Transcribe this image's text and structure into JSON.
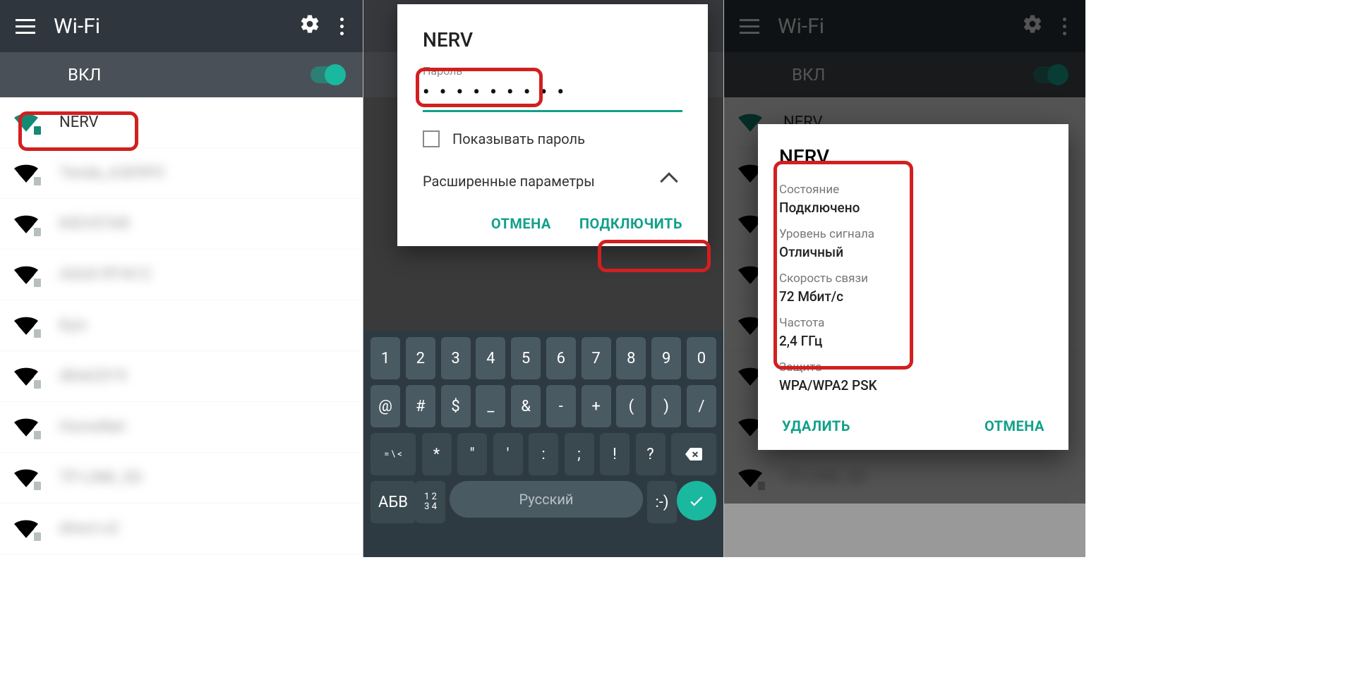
{
  "screen1": {
    "title": "Wi-Fi",
    "toggle_label": "ВКЛ",
    "networks": [
      {
        "name": "NERV",
        "highlighted": true
      },
      {
        "name": "Tenda_A3D9F0",
        "blur": true
      },
      {
        "name": "KIEVSTAR",
        "blur": true
      },
      {
        "name": "ASUS RT-N12",
        "blur": true
      },
      {
        "name": "Kyiv",
        "blur": true
      },
      {
        "name": "dlink2019",
        "blur": true
      },
      {
        "name": "HomeNet",
        "blur": true
      },
      {
        "name": "TP-LINK_5G",
        "blur": true
      },
      {
        "name": "direct-x2",
        "blur": true
      }
    ]
  },
  "screen2": {
    "dialog": {
      "title": "NERV",
      "password_label": "Пароль",
      "password_masked": "• • • • • • • • •",
      "show_password": "Показывать пароль",
      "advanced": "Расширенные параметры",
      "cancel": "ОТМЕНА",
      "connect": "ПОДКЛЮЧИТЬ"
    },
    "keyboard": {
      "row1": [
        "1",
        "2",
        "3",
        "4",
        "5",
        "6",
        "7",
        "8",
        "9",
        "0"
      ],
      "row2": [
        "@",
        "#",
        "$",
        "_",
        "&",
        "-",
        "+",
        "(",
        ")",
        "/"
      ],
      "row3_shift": "= \\ <",
      "row3": [
        "*",
        "\"",
        "'",
        ":",
        ";",
        "!",
        "?"
      ],
      "row4_mode": "АБВ",
      "row4_alt": "1 2\n3 4",
      "space": "Русский",
      "emoji": ":-)"
    }
  },
  "screen3": {
    "title": "Wi-Fi",
    "toggle_label": "ВКЛ",
    "dialog": {
      "title": "NERV",
      "items": [
        {
          "k": "Состояние",
          "v": "Подключено"
        },
        {
          "k": "Уровень сигнала",
          "v": "Отличный"
        },
        {
          "k": "Скорость связи",
          "v": "72 Мбит/с"
        },
        {
          "k": "Частота",
          "v": "2,4 ГГц"
        },
        {
          "k": "Защита",
          "v": "WPA/WPA2 PSK"
        }
      ],
      "delete": "УДАЛИТЬ",
      "cancel": "ОТМЕНА"
    }
  }
}
